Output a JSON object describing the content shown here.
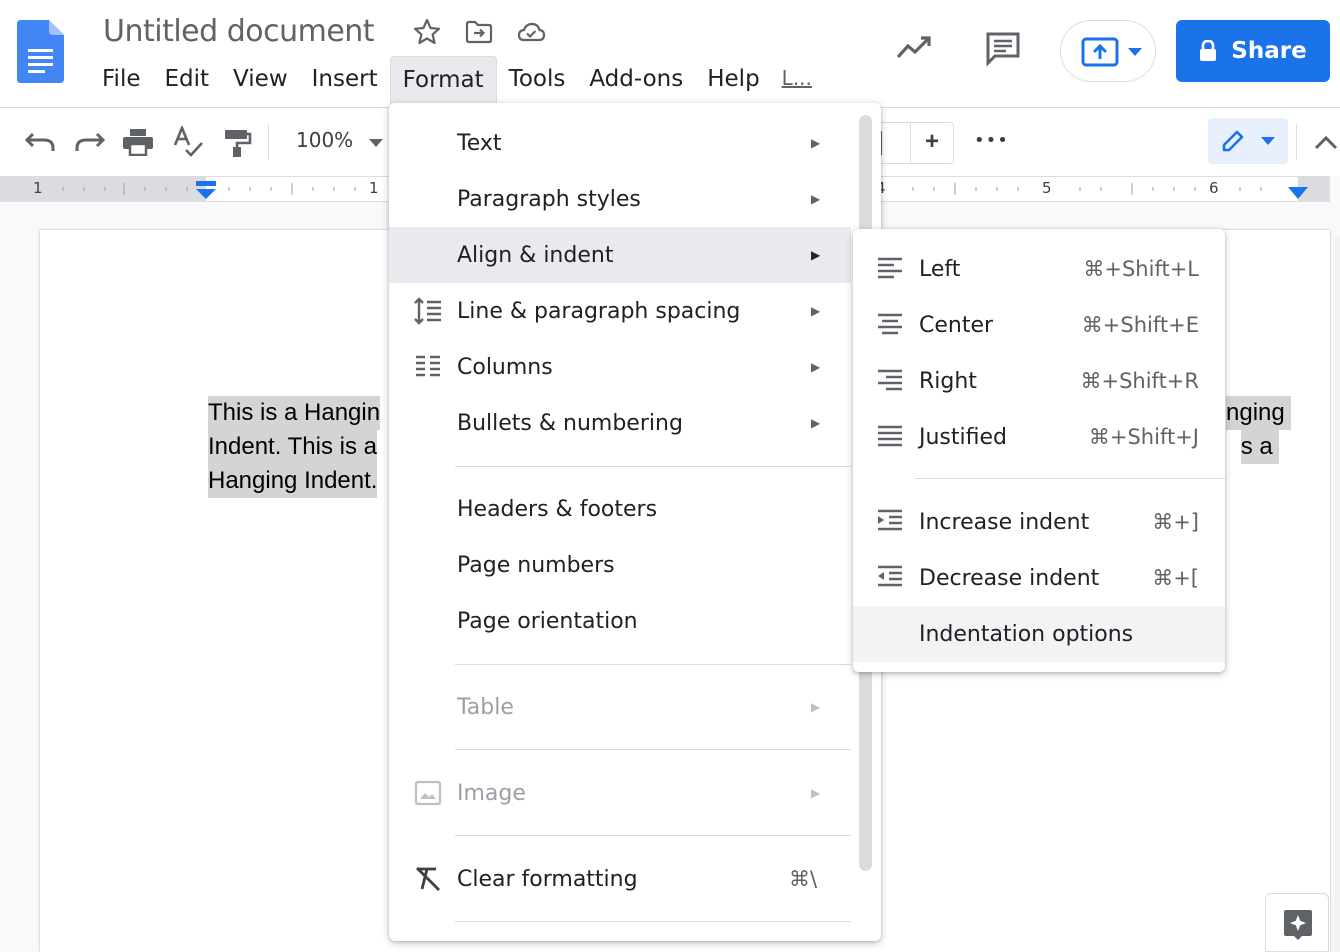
{
  "document": {
    "title": "Untitled document",
    "title_icons": [
      "star-icon",
      "move-to-folder-icon",
      "cloud-saved-icon"
    ]
  },
  "menubar": {
    "items": [
      "File",
      "Edit",
      "View",
      "Insert",
      "Format",
      "Tools",
      "Add-ons",
      "Help"
    ],
    "active": "Format",
    "last_edit": "L..."
  },
  "header_actions": {
    "icons": [
      "activity-dashboard-icon",
      "comments-icon",
      "present-icon"
    ],
    "share_label": "Share"
  },
  "toolbar": {
    "icons": [
      "undo-icon",
      "redo-icon",
      "print-icon",
      "spellcheck-icon",
      "paint-format-icon",
      "zoom-dropdown-icon",
      "increase-font-icon",
      "more-icon",
      "edit-mode-icon",
      "collapse-icon"
    ],
    "zoom": "100%",
    "plus": "+",
    "more": "•••"
  },
  "ruler": {
    "numbers": [
      "1",
      "1",
      "4",
      "5",
      "6"
    ]
  },
  "page_text": {
    "left_lines": [
      "This is a Hangin",
      "Indent. This is a",
      "Hanging Indent."
    ],
    "right_lines": [
      "nging",
      "s a"
    ]
  },
  "format_menu": {
    "items": [
      {
        "label": "Text",
        "has_submenu": true
      },
      {
        "label": "Paragraph styles",
        "has_submenu": true
      },
      {
        "label": "Align & indent",
        "has_submenu": true,
        "highlighted": true
      },
      {
        "label": "Line & paragraph spacing",
        "has_submenu": true,
        "icon": "line-spacing-icon"
      },
      {
        "label": "Columns",
        "has_submenu": true,
        "icon": "columns-icon"
      },
      {
        "label": "Bullets & numbering",
        "has_submenu": true
      },
      {
        "label": "Headers & footers"
      },
      {
        "label": "Page numbers"
      },
      {
        "label": "Page orientation"
      },
      {
        "label": "Table",
        "has_submenu": true,
        "disabled": true
      },
      {
        "label": "Image",
        "has_submenu": true,
        "disabled": true,
        "icon": "image-icon"
      },
      {
        "label": "Clear formatting",
        "shortcut": "⌘\\",
        "icon": "clear-formatting-icon"
      }
    ],
    "arrow": "▶"
  },
  "align_submenu": {
    "items": [
      {
        "label": "Left",
        "shortcut": "⌘+Shift+L",
        "icon": "align-left-icon"
      },
      {
        "label": "Center",
        "shortcut": "⌘+Shift+E",
        "icon": "align-center-icon"
      },
      {
        "label": "Right",
        "shortcut": "⌘+Shift+R",
        "icon": "align-right-icon"
      },
      {
        "label": "Justified",
        "shortcut": "⌘+Shift+J",
        "icon": "align-justify-icon"
      },
      {
        "label": "Increase indent",
        "shortcut": "⌘+]",
        "icon": "increase-indent-icon"
      },
      {
        "label": "Decrease indent",
        "shortcut": "⌘+[",
        "icon": "decrease-indent-icon"
      },
      {
        "label": "Indentation options",
        "highlighted": true
      }
    ]
  },
  "colors": {
    "accent": "#1a73e8",
    "menu_highlight": "#e8eaed",
    "text": "#202124",
    "disabled": "#9aa0a6"
  }
}
